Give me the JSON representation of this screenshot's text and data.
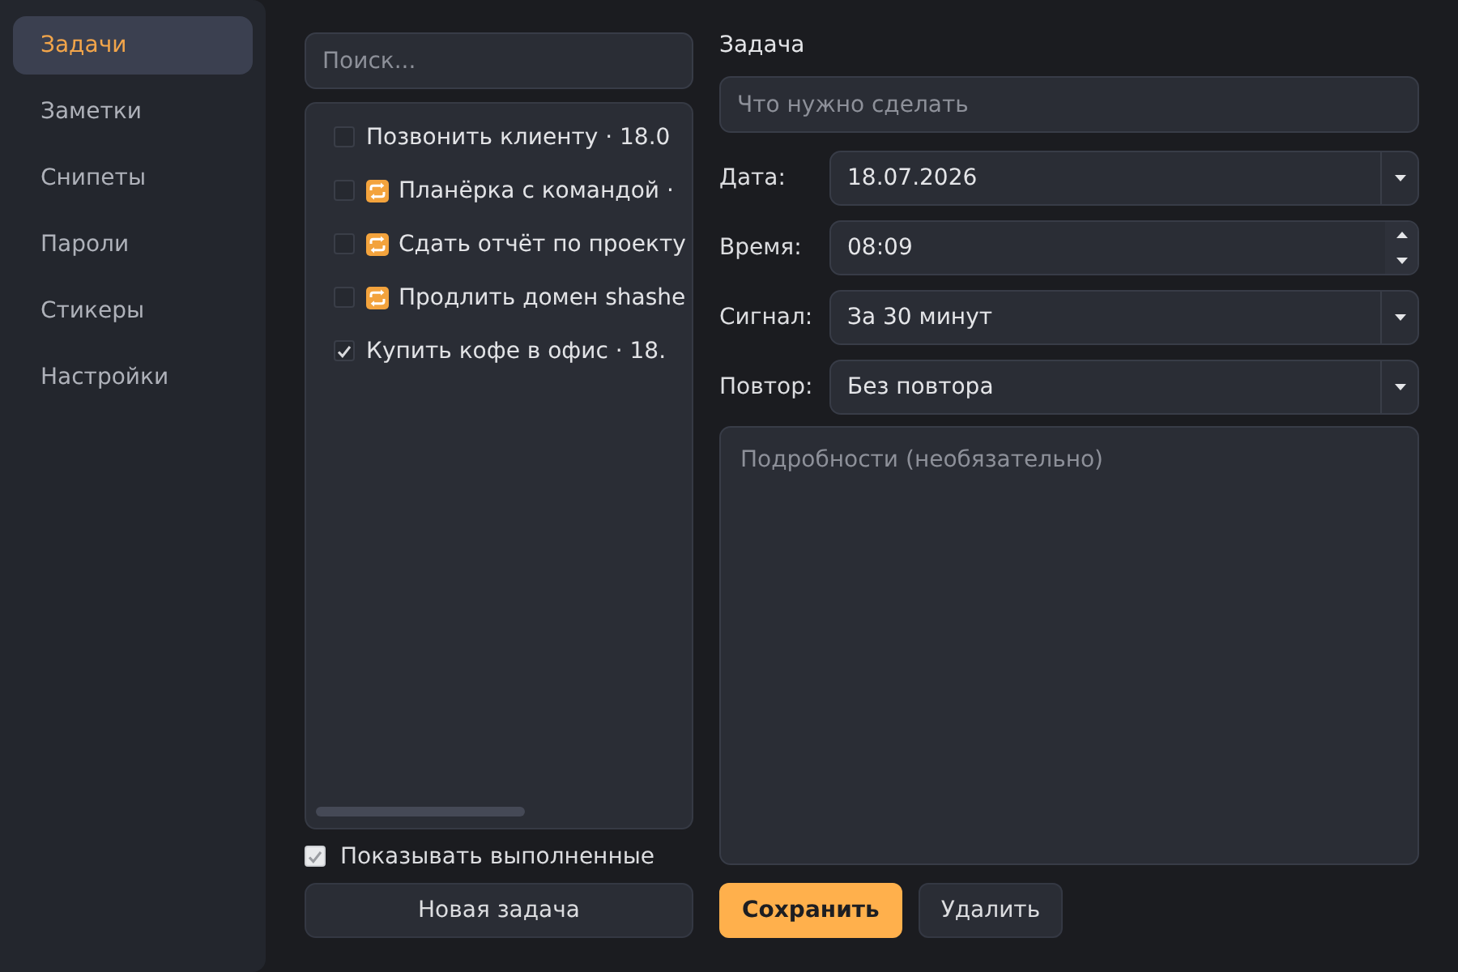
{
  "sidebar": {
    "items": [
      {
        "label": "Задачи",
        "selected": true
      },
      {
        "label": "Заметки",
        "selected": false
      },
      {
        "label": "Снипеты",
        "selected": false
      },
      {
        "label": "Пароли",
        "selected": false
      },
      {
        "label": "Стикеры",
        "selected": false
      },
      {
        "label": "Настройки",
        "selected": false
      }
    ]
  },
  "task_list": {
    "search": {
      "placeholder": "Поиск..."
    },
    "items": [
      {
        "text": "Позвонить клиенту · 18.0",
        "done": false,
        "repeat": false
      },
      {
        "text": "Планёрка с командой ·",
        "done": false,
        "repeat": true
      },
      {
        "text": "Сдать отчёт по проекту",
        "done": false,
        "repeat": true
      },
      {
        "text": "Продлить домен shashe",
        "done": false,
        "repeat": true
      },
      {
        "text": "Купить кофе в офис · 18.",
        "done": true,
        "repeat": false
      }
    ],
    "show_completed": {
      "label": "Показывать выполненные",
      "checked": true
    },
    "new_button": "Новая задача"
  },
  "editor": {
    "title": "Задача",
    "name_field": {
      "placeholder": "Что нужно сделать"
    },
    "fields": [
      {
        "kind": "dropdown",
        "label": "Дата:",
        "value": "18.07.2026"
      },
      {
        "kind": "spin",
        "label": "Время:",
        "value": "08:09"
      },
      {
        "kind": "dropdown",
        "label": "Сигнал:",
        "value": "За 30 минут"
      },
      {
        "kind": "dropdown",
        "label": "Повтор:",
        "value": "Без повтора"
      }
    ],
    "details": {
      "placeholder": "Подробности (необязательно)"
    },
    "buttons": [
      {
        "label": "Сохранить",
        "kind": "primary"
      },
      {
        "label": "Удалить",
        "kind": "secondary"
      }
    ]
  }
}
